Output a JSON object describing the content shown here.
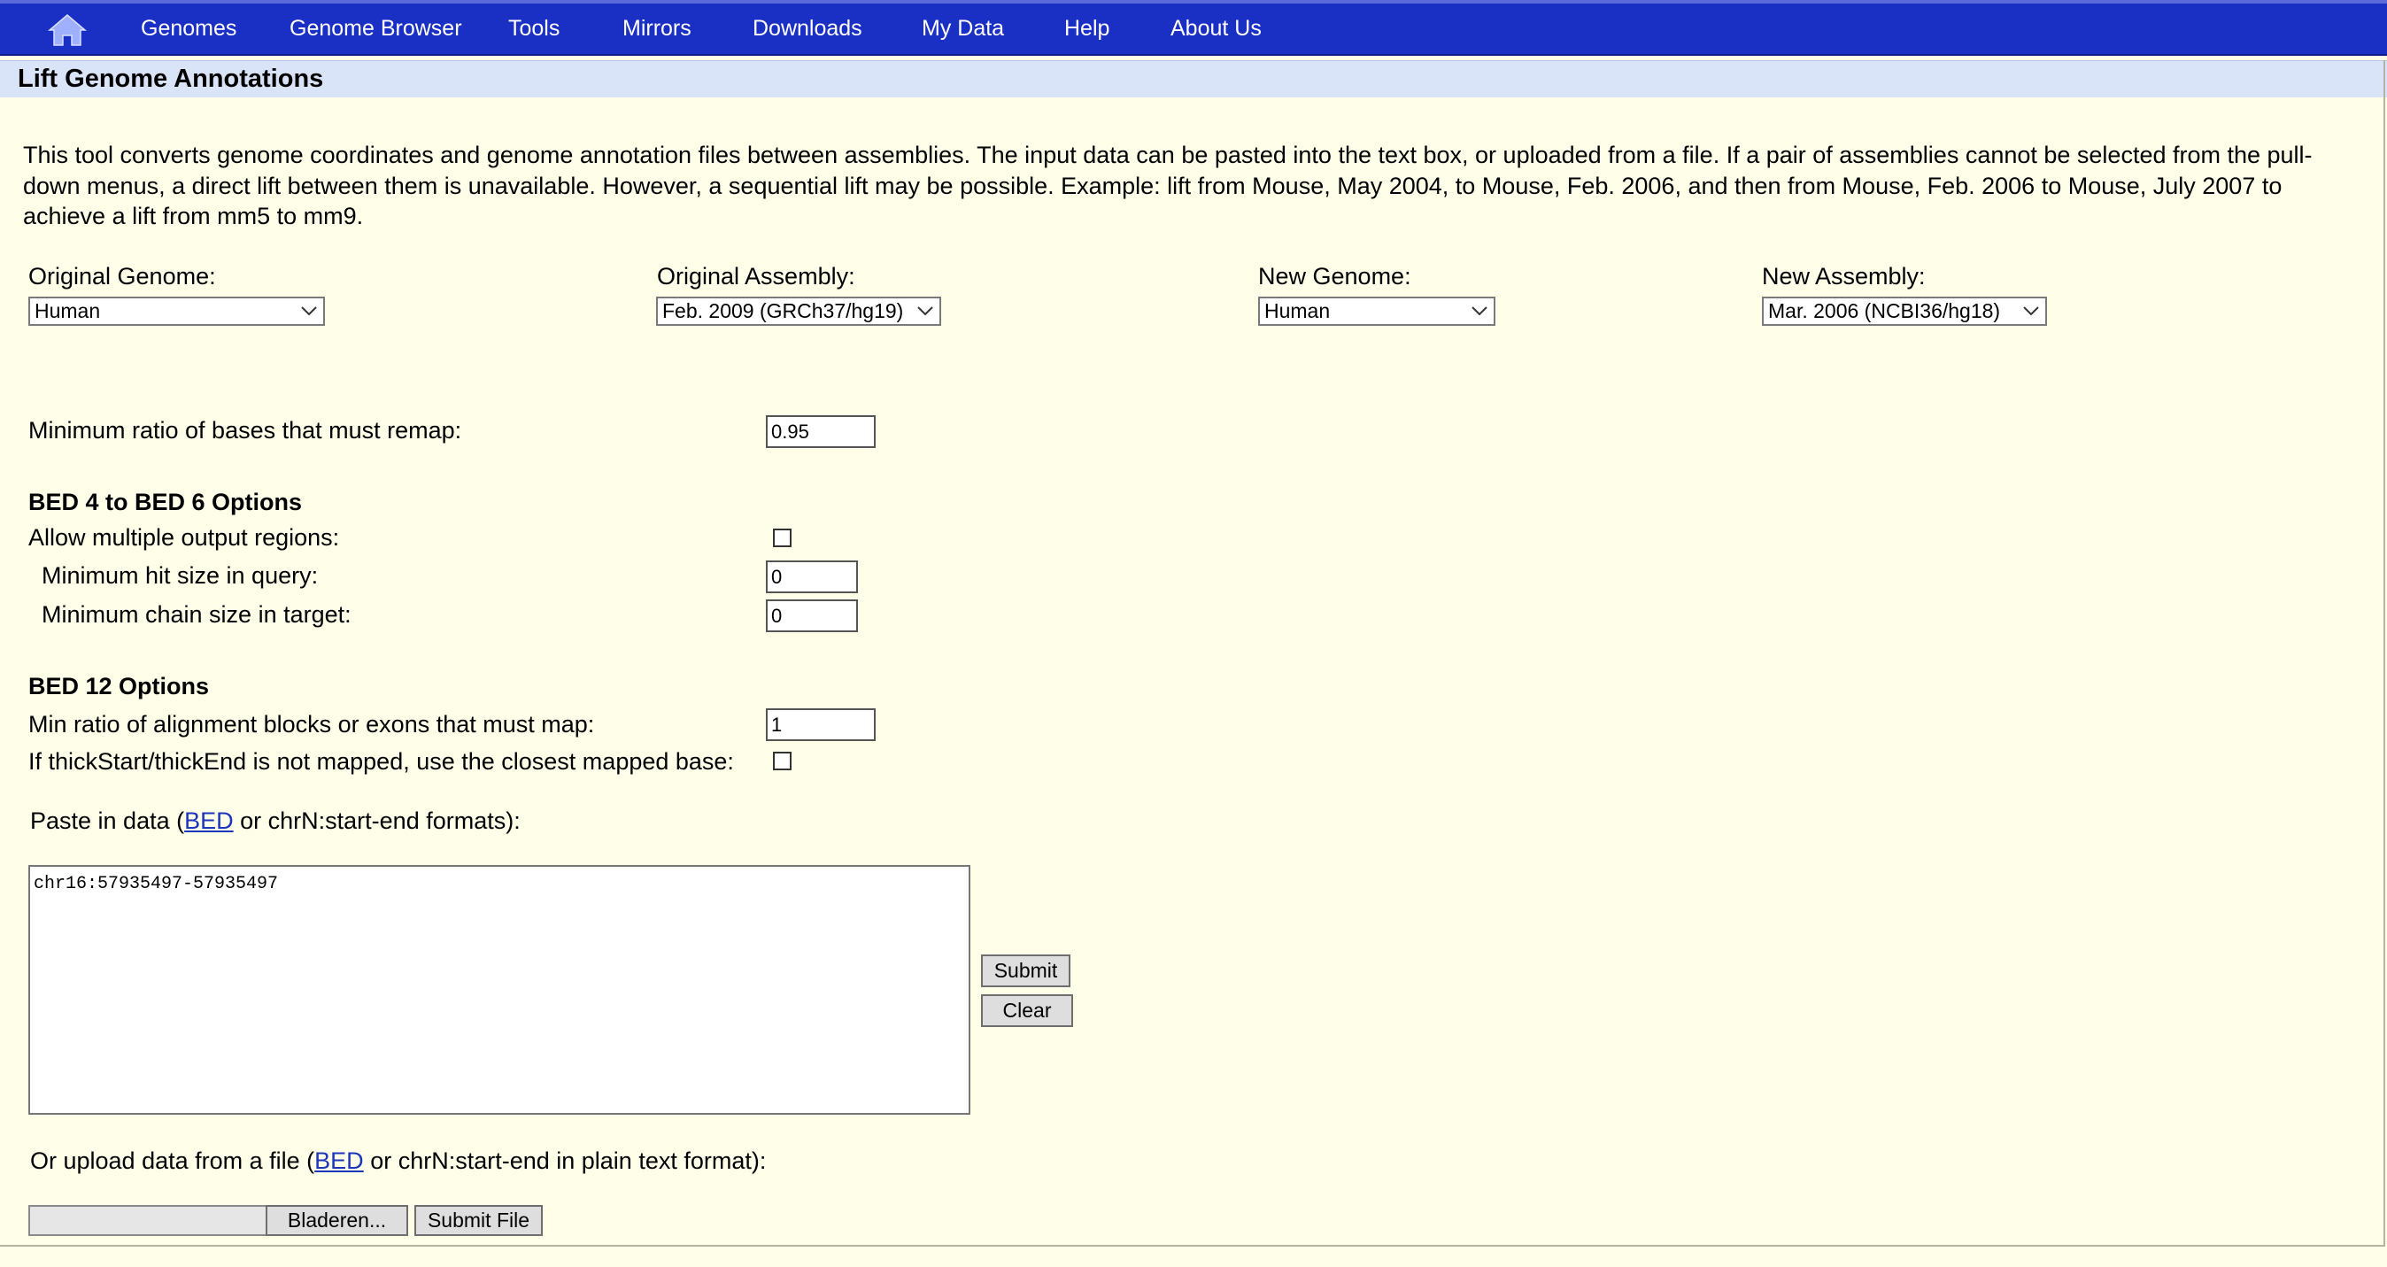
{
  "nav": {
    "home_icon": "home-icon",
    "items": [
      "Genomes",
      "Genome Browser",
      "Tools",
      "Mirrors",
      "Downloads",
      "My Data",
      "Help",
      "About Us"
    ]
  },
  "page": {
    "title": "Lift Genome Annotations",
    "intro": "This tool converts genome coordinates and genome annotation files between assemblies.  The input data can be pasted into the text box, or uploaded from a file.  If a pair of assemblies cannot be selected from the pull-down menus, a direct lift between them is unavailable.  However, a sequential lift may be possible.  Example: lift from Mouse, May 2004, to Mouse, Feb. 2006, and then from Mouse, Feb. 2006 to Mouse, July 2007 to achieve a lift from mm5 to mm9."
  },
  "selectors": {
    "original_genome": {
      "label": "Original Genome:",
      "value": "Human"
    },
    "original_assembly": {
      "label": "Original Assembly:",
      "value": "Feb. 2009 (GRCh37/hg19)"
    },
    "new_genome": {
      "label": "New Genome:",
      "value": "Human"
    },
    "new_assembly": {
      "label": "New Assembly:",
      "value": "Mar. 2006 (NCBI36/hg18)"
    }
  },
  "options": {
    "min_ratio": {
      "label": "Minimum ratio of bases that must remap:",
      "value": "0.95"
    },
    "bed4to6": {
      "heading": "BED 4 to BED 6 Options",
      "allow_multiple_label": "Allow multiple output regions:",
      "allow_multiple_checked": false,
      "min_hit_label": "Minimum hit size in query:",
      "min_hit_value": "0",
      "min_chain_label": "Minimum chain size in target:",
      "min_chain_value": "0"
    },
    "bed12": {
      "heading": "BED 12 Options",
      "min_blocks_label": "Min ratio of alignment blocks or exons that must map:",
      "min_blocks_value": "1",
      "thick_label": "If thickStart/thickEnd is not mapped, use the closest mapped base:",
      "thick_checked": false
    }
  },
  "paste": {
    "label_prefix": "Paste in data (",
    "link": "BED",
    "label_suffix": " or chrN:start-end formats):",
    "value": "chr16:57935497-57935497",
    "submit": "Submit",
    "clear": "Clear"
  },
  "upload": {
    "label_prefix": "Or upload data from a file (",
    "link": "BED",
    "label_suffix": " or chrN:start-end in plain text format):",
    "browse": "Bladeren...",
    "submit_file": "Submit File"
  },
  "colors": {
    "nav_bg": "#1a30c4",
    "page_bg": "#fffee8",
    "title_bar_bg": "#d9e4f8",
    "link": "#1b35bd"
  }
}
